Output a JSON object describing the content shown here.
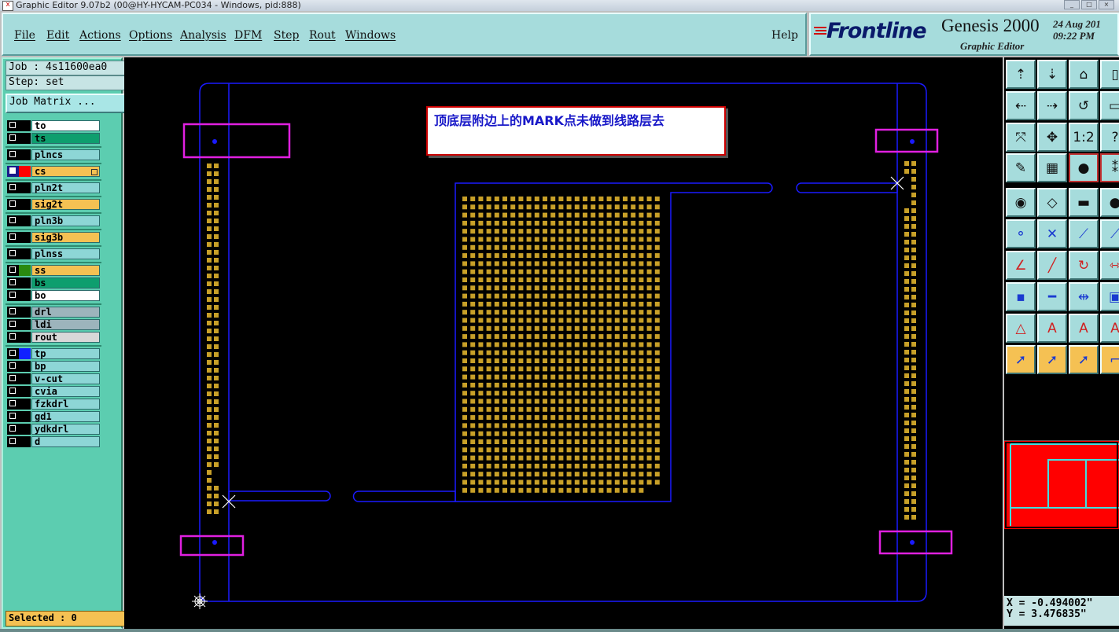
{
  "window": {
    "title": "Graphic Editor 9.07b2 (00@HY-HYCAM-PC034 - Windows, pid:888)"
  },
  "menu": {
    "items": [
      "File",
      "Edit",
      "Actions",
      "Options",
      "Analysis",
      "DFM",
      "Step",
      "Rout",
      "Windows"
    ],
    "help": "Help"
  },
  "brand": {
    "logo": "Frontline",
    "product": "Genesis 2000",
    "subtitle": "Graphic Editor",
    "date": "24 Aug 201",
    "time": "09:22 PM"
  },
  "job": {
    "job_label": "Job : 4s11600ea0",
    "step_label": "Step: set",
    "job_matrix_button": "Job Matrix ..."
  },
  "layers": [
    {
      "name": "to",
      "color": "#000000",
      "bg": "#ffffff"
    },
    {
      "name": "ts",
      "color": "#000000",
      "bg": "#0e9e6e"
    },
    {
      "name": "plncs",
      "color": "#000000",
      "bg": "#8dd6d6"
    },
    {
      "name": "cs",
      "color": "#ff0000",
      "bg": "#f5c153",
      "active": true
    },
    {
      "name": "pln2t",
      "color": "#000000",
      "bg": "#8dd6d6"
    },
    {
      "name": "sig2t",
      "color": "#000000",
      "bg": "#f5c153"
    },
    {
      "name": "pln3b",
      "color": "#000000",
      "bg": "#8dd6d6"
    },
    {
      "name": "sig3b",
      "color": "#000000",
      "bg": "#f5c153"
    },
    {
      "name": "plnss",
      "color": "#000000",
      "bg": "#8dd6d6"
    },
    {
      "name": "ss",
      "color": "#2a8a10",
      "bg": "#f5c153"
    },
    {
      "name": "bs",
      "color": "#000000",
      "bg": "#0e9e6e"
    },
    {
      "name": "bo",
      "color": "#000000",
      "bg": "#ffffff"
    },
    {
      "name": "drl",
      "color": "#000000",
      "bg": "#9cb4bc"
    },
    {
      "name": "ldi",
      "color": "#000000",
      "bg": "#9cb4bc"
    },
    {
      "name": "rout",
      "color": "#000000",
      "bg": "#d8d8d8"
    },
    {
      "name": "tp",
      "color": "#1020ff",
      "bg": "#8dd6d6"
    },
    {
      "name": "bp",
      "color": "#000000",
      "bg": "#8dd6d6"
    },
    {
      "name": "v-cut",
      "color": "#000000",
      "bg": "#8dd6d6"
    },
    {
      "name": "cvia",
      "color": "#000000",
      "bg": "#8dd6d6"
    },
    {
      "name": "fzkdrl",
      "color": "#000000",
      "bg": "#8dd6d6"
    },
    {
      "name": "gd1",
      "color": "#000000",
      "bg": "#8dd6d6"
    },
    {
      "name": "ydkdrl",
      "color": "#000000",
      "bg": "#8dd6d6"
    },
    {
      "name": "d",
      "color": "#000000",
      "bg": "#8dd6d6"
    }
  ],
  "status": {
    "selected": "Selected : 0"
  },
  "annotation": {
    "note": "顶底层附边上的MARK点未做到线路层去"
  },
  "cursor_readout": {
    "x": "X = -0.494002\"",
    "y": "Y = 3.476835\""
  },
  "colors": {
    "pad": "#c8a028",
    "outline": "#1a1aff",
    "mark_box": "#e020e0",
    "note_border": "#cc0000",
    "preview": "#ff0000"
  }
}
